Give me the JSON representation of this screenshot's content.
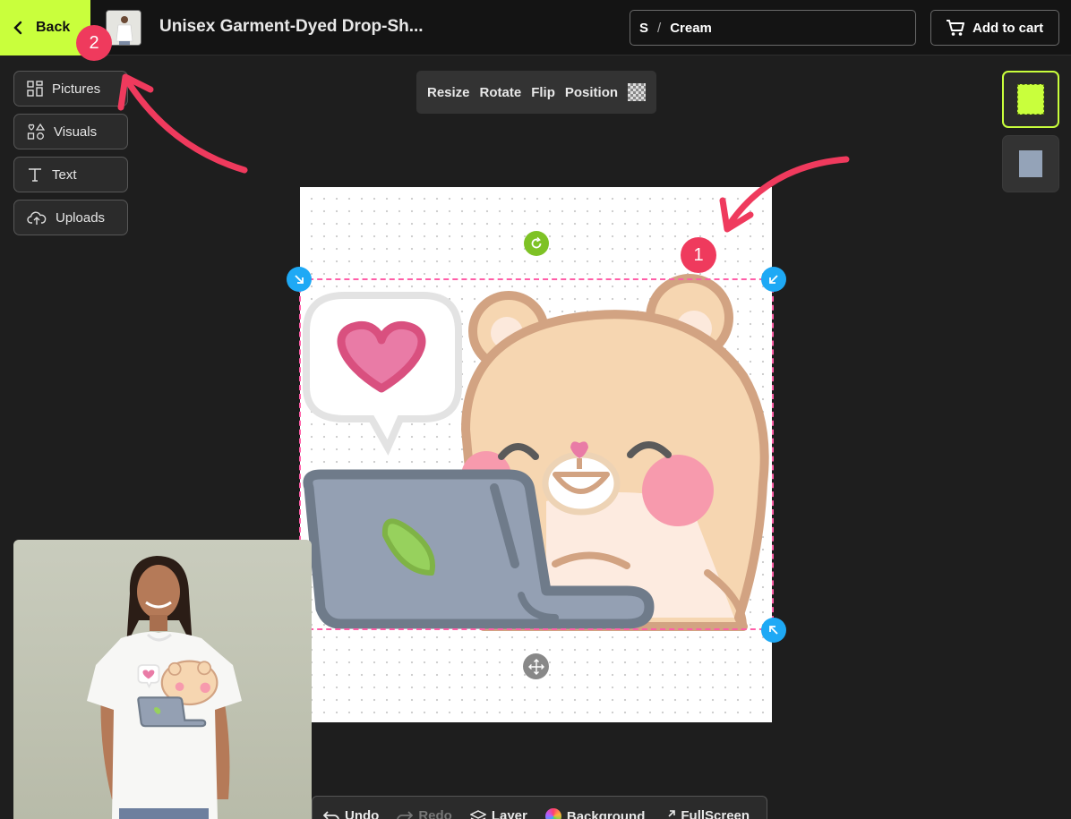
{
  "header": {
    "back_label": "Back",
    "product_title": "Unisex Garment-Dyed Drop-Sh...",
    "variant_size": "S",
    "variant_sep": "/",
    "variant_color": "Cream",
    "cart_label": "Add to cart"
  },
  "tools": [
    {
      "label": "Pictures",
      "icon": "grid-icon"
    },
    {
      "label": "Visuals",
      "icon": "shapes-icon"
    },
    {
      "label": "Text",
      "icon": "text-icon"
    },
    {
      "label": "Uploads",
      "icon": "cloud-upload-icon"
    }
  ],
  "toolbar": {
    "resize": "Resize",
    "rotate": "Rotate",
    "flip": "Flip",
    "position": "Position"
  },
  "bottom": {
    "undo": "Undo",
    "redo": "Redo",
    "layer": "Layer",
    "background": "Background",
    "fullscreen": "FullScreen"
  },
  "badges": {
    "one": "1",
    "two": "2"
  },
  "colors": {
    "accent": "#c9ff3c",
    "selection": "#ff5fa8",
    "handle": "#1ea9f5",
    "rotate": "#7ec225",
    "badge": "#ef3a5d",
    "swatch_back": "#94a3b8"
  }
}
